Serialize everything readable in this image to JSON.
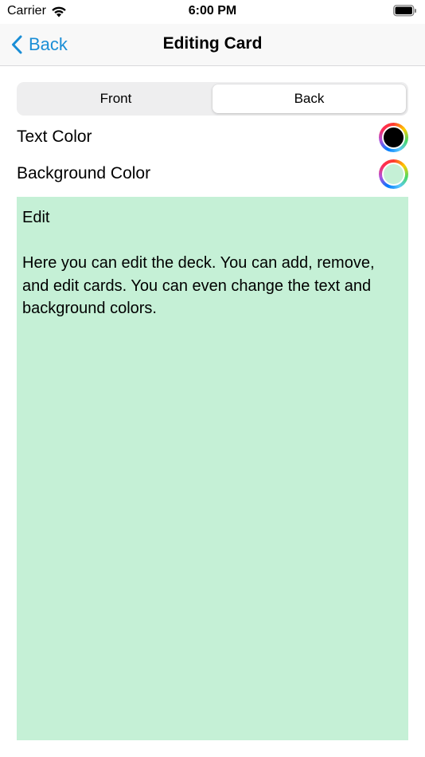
{
  "status_bar": {
    "carrier": "Carrier",
    "time": "6:00 PM"
  },
  "nav": {
    "back_label": "Back",
    "title": "Editing Card"
  },
  "segmented": {
    "options": [
      "Front",
      "Back"
    ],
    "selected": "Back"
  },
  "settings": {
    "text_color_label": "Text Color",
    "text_color_value": "#000000",
    "background_color_label": "Background Color",
    "background_color_value": "#c5f0d6"
  },
  "card": {
    "text": "Edit\n\nHere you can edit the deck. You can add, remove, and edit cards. You can even change the text and background colors."
  },
  "colors": {
    "accent": "#1a8ed6",
    "card_background": "#c5f0d6",
    "card_text": "#000000"
  }
}
